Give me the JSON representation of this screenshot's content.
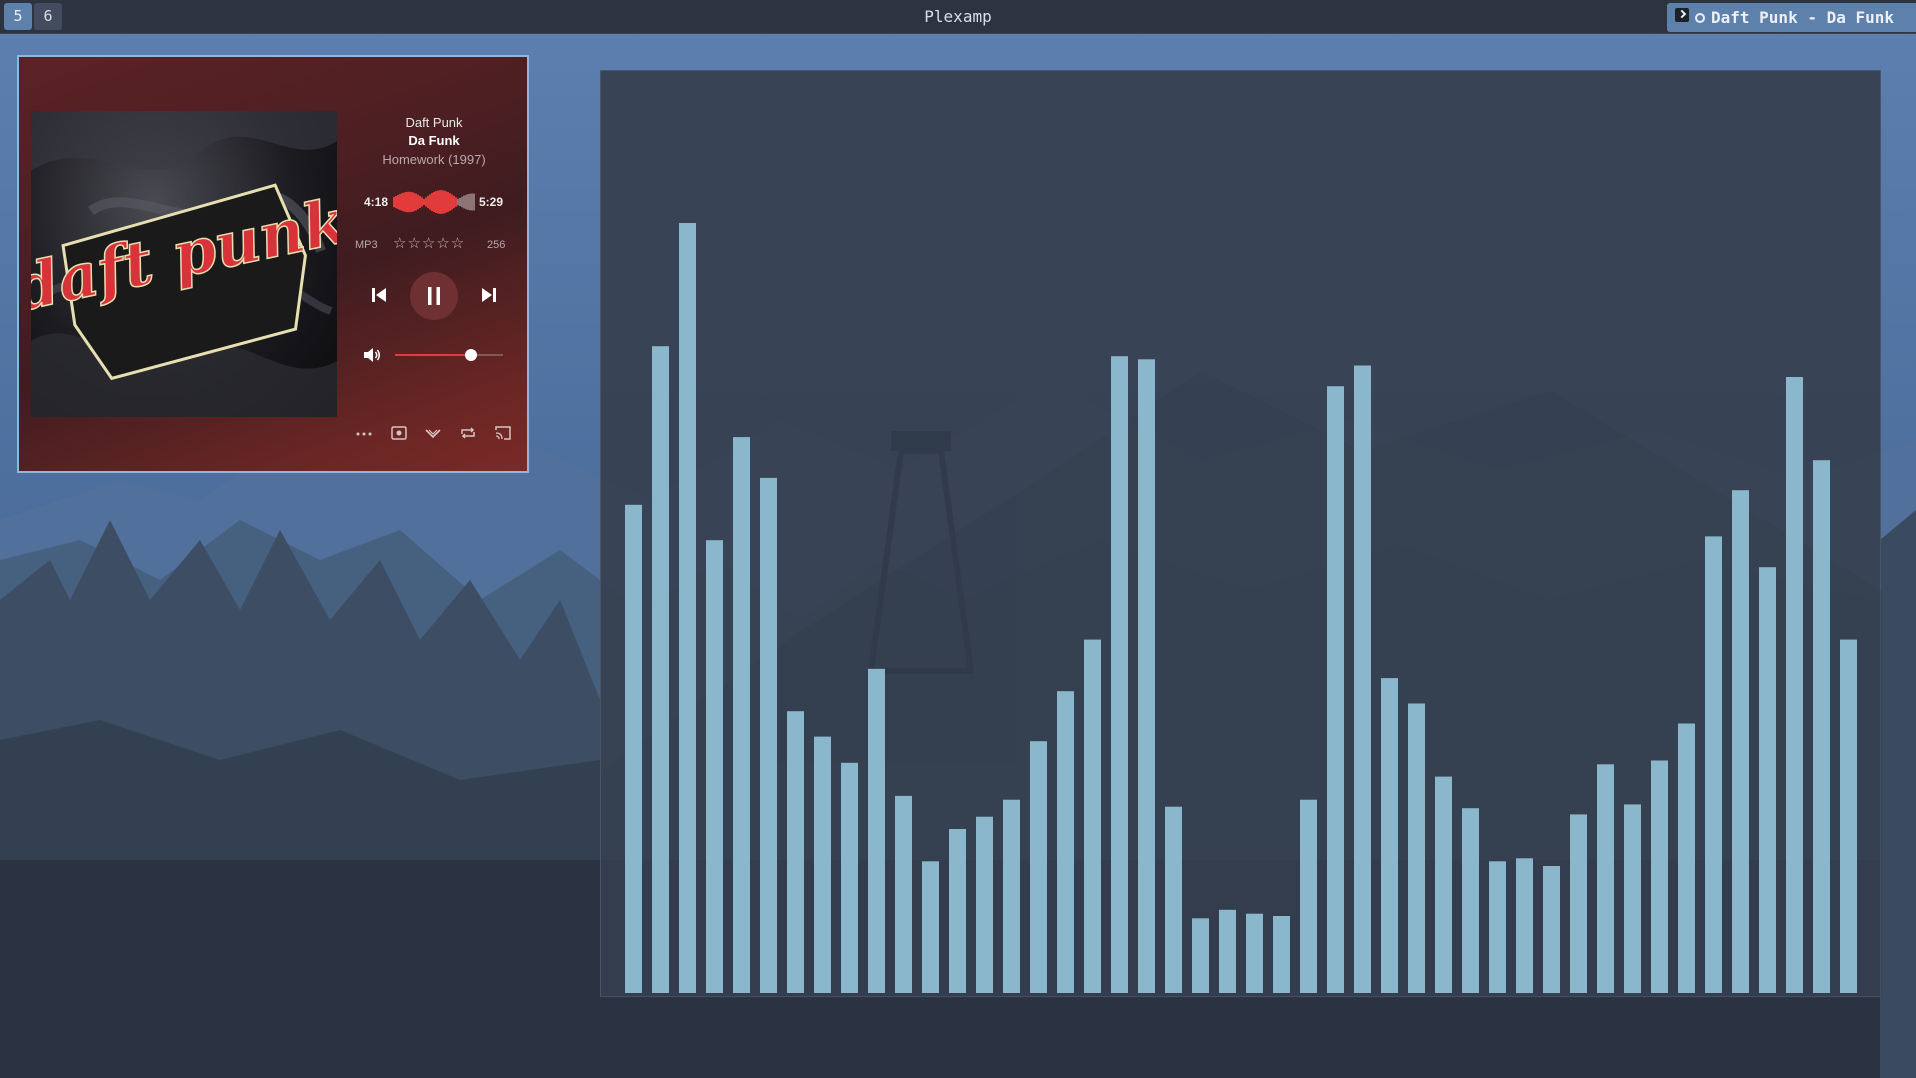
{
  "topbar": {
    "workspaces": [
      {
        "label": "5",
        "active": true
      },
      {
        "label": "6",
        "active": false
      }
    ],
    "window_title": "Plexamp",
    "now_playing": "Daft Punk - Da Funk"
  },
  "player": {
    "artist": "Daft Punk",
    "track": "Da Funk",
    "album": "Homework (1997)",
    "album_art_text": "daft punk",
    "elapsed": "4:18",
    "total": "5:29",
    "progress": 0.784,
    "format": "MP3",
    "rating_stars": "☆☆☆☆☆",
    "bitrate": "256",
    "volume": 0.7,
    "icons": {
      "previous": "skip-previous-icon",
      "pause": "pause-icon",
      "next": "skip-next-icon",
      "volume": "speaker-icon",
      "more": "ellipsis-icon",
      "lyrics": "lyrics-icon",
      "collapse": "chevron-down-icon",
      "repeat": "repeat-icon",
      "cast": "cast-icon"
    },
    "accent_color": "#e23b3b"
  },
  "visualizer": {
    "bar_color": "#8ab7cc",
    "levels": [
      0.634,
      0.84,
      1.0,
      0.588,
      0.722,
      0.669,
      0.366,
      0.333,
      0.299,
      0.421,
      0.256,
      0.171,
      0.213,
      0.229,
      0.251,
      0.327,
      0.392,
      0.459,
      0.827,
      0.823,
      0.242,
      0.097,
      0.108,
      0.103,
      0.1,
      0.251,
      0.788,
      0.815,
      0.409,
      0.376,
      0.281,
      0.24,
      0.171,
      0.175,
      0.165,
      0.232,
      0.297,
      0.245,
      0.302,
      0.35,
      0.593,
      0.653,
      0.553,
      0.8,
      0.692,
      0.459
    ]
  }
}
